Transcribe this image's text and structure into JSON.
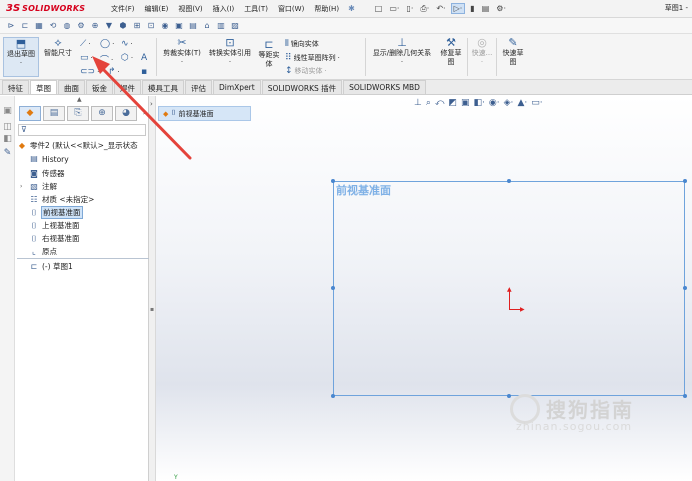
{
  "app": {
    "logo_mark": "3S",
    "logo_text": "SOLIDWORKS",
    "window_title": "草图1 -"
  },
  "menu": [
    "文件(F)",
    "编辑(E)",
    "视图(V)",
    "插入(I)",
    "工具(T)",
    "窗口(W)",
    "帮助(H)"
  ],
  "quick_access": [
    "□",
    "▭·",
    "▯·",
    "⎙·",
    "↶·",
    "▷·",
    "▮",
    "▤",
    "⚙·"
  ],
  "ribbon": {
    "exit_sketch": "退出草图",
    "smart_dimension": "智能尺寸",
    "trim_entities": "剪裁实体(T)",
    "convert_entities": "转换实体引用",
    "offset_entities": "等距实体",
    "mirror_entities": "镜向实体",
    "linear_pattern": "线性草图阵列",
    "move_entities": "移动实体",
    "show_relations": "显示/删除几何关系",
    "repair_sketch": "修复草图",
    "quick_snaps": "快速...",
    "rapid_sketch": "快速草图"
  },
  "tabs": [
    "特征",
    "草图",
    "曲面",
    "钣金",
    "焊件",
    "模具工具",
    "评估",
    "DimXpert",
    "SOLIDWORKS 插件",
    "SOLIDWORKS MBD"
  ],
  "active_tab": "草图",
  "feature_tree": {
    "root": "零件2  (默认<<默认>_显示状态",
    "items": [
      "History",
      "传感器",
      "注解",
      "材质 <未指定>",
      "前视基准面",
      "上视基准面",
      "右视基准面",
      "原点",
      "(-) 草图1"
    ]
  },
  "graphics": {
    "breadcrumb": "前视基准面",
    "plane_label": "前视基准面",
    "watermark": "搜狗指南",
    "watermark_url": "zhinan.sogou.com"
  },
  "colors": {
    "brand_red": "#d6001c",
    "plane_border": "#6fa3dc",
    "origin": "#e02020",
    "selection": "#cfe3f8"
  }
}
